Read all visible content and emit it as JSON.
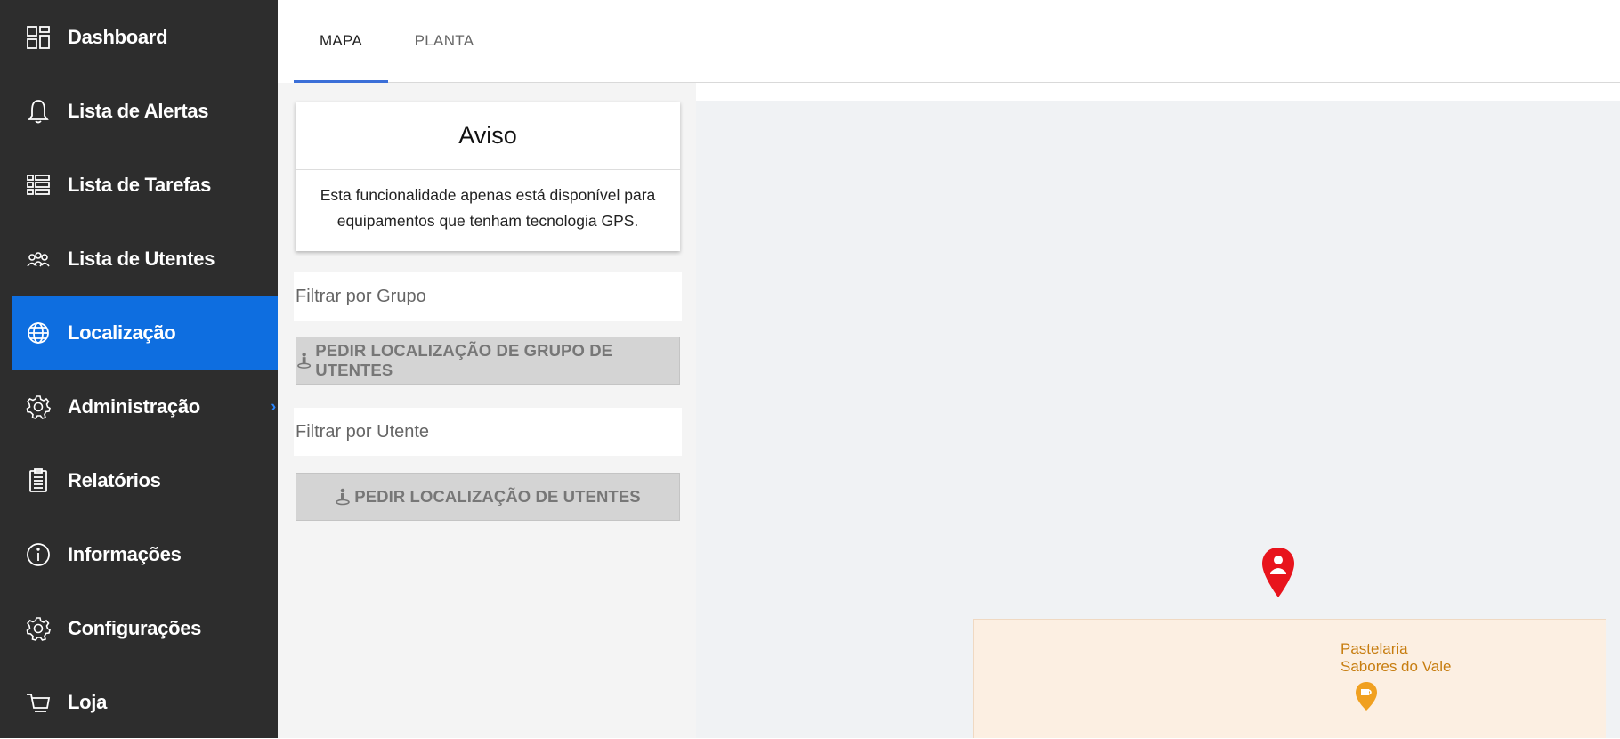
{
  "sidebar": {
    "items": [
      {
        "label": "Dashboard",
        "icon": "dashboard-icon"
      },
      {
        "label": "Lista de Alertas",
        "icon": "bell-icon"
      },
      {
        "label": "Lista de Tarefas",
        "icon": "task-list-icon"
      },
      {
        "label": "Lista de Utentes",
        "icon": "users-icon"
      },
      {
        "label": "Localização",
        "icon": "globe-icon",
        "active": true
      },
      {
        "label": "Administração",
        "icon": "gear-icon",
        "has_submenu": true
      },
      {
        "label": "Relatórios",
        "icon": "report-icon"
      },
      {
        "label": "Informações",
        "icon": "info-icon"
      },
      {
        "label": "Configurações",
        "icon": "gear-icon"
      },
      {
        "label": "Loja",
        "icon": "cart-icon"
      }
    ],
    "chevron": "›"
  },
  "tabs": [
    {
      "label": "MAPA",
      "active": true
    },
    {
      "label": "PLANTA",
      "active": false
    }
  ],
  "notice": {
    "title": "Aviso",
    "body": "Esta funcionalidade apenas está disponível para equipamentos que tenham tecnologia GPS."
  },
  "group_filter": {
    "placeholder": "Filtrar por Grupo",
    "value": ""
  },
  "group_button": {
    "label": "PEDIR LOCALIZAÇÃO DE GRUPO DE UTENTES"
  },
  "user_filter": {
    "placeholder": "Filtrar por Utente",
    "value": ""
  },
  "user_button": {
    "label": "PEDIR LOCALIZAÇÃO DE UTENTES"
  },
  "map": {
    "poi_label_line1": "Pastelaria",
    "poi_label_line2": "Sabores do Vale"
  },
  "colors": {
    "sidebar_bg": "#2d2d2d",
    "active_item": "#0e6ee0",
    "tab_underline": "#3b6fd8",
    "pin": "#e8141c",
    "poi": "#f0a020"
  }
}
